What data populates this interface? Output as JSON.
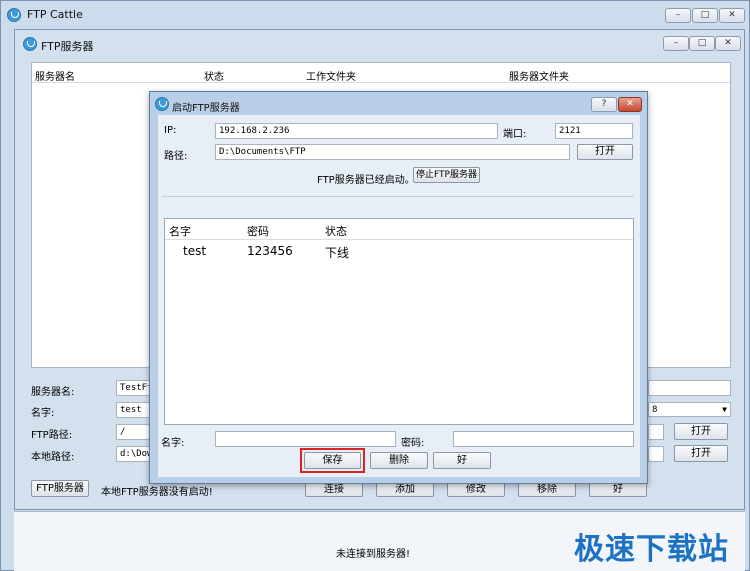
{
  "outer": {
    "title": "FTP Cattle"
  },
  "inner": {
    "title": "FTP服务器"
  },
  "server_table": {
    "columns": [
      "服务器名",
      "状态",
      "工作文件夹",
      "服务器文件夹"
    ]
  },
  "form": {
    "server_name_label": "服务器名:",
    "server_name_value": "TestFt",
    "name_label": "名字:",
    "name_value": "test",
    "ftp_path_label": "FTP路径:",
    "ftp_path_value": "/",
    "local_path_label": "本地路径:",
    "local_path_value": "d:\\Dow",
    "encoding_value": "8",
    "open_label": "打开"
  },
  "bottom": {
    "ftp_server_button": "FTP服务器",
    "local_status": "本地FTP服务器没有启动!",
    "connect": "连接",
    "add": "添加",
    "modify": "修改",
    "remove": "移除",
    "ok": "好"
  },
  "status": {
    "text": "未连接到服务器!"
  },
  "dialog": {
    "title": "启动FTP服务器",
    "help": "?",
    "ip_label": "IP:",
    "ip_value": "192.168.2.236",
    "port_label": "端口:",
    "port_value": "2121",
    "path_label": "路径:",
    "path_value": "D:\\Documents\\FTP",
    "open_label": "打开",
    "status_text": "FTP服务器已经启动。",
    "stop_button": "停止FTP服务器",
    "columns": [
      "名字",
      "密码",
      "状态"
    ],
    "rows": [
      {
        "name": "test",
        "password": "123456",
        "state": "下线"
      }
    ],
    "name_label": "名字:",
    "password_label": "密码:",
    "save": "保存",
    "delete": "删除",
    "ok": "好"
  },
  "watermark": "极速下载站",
  "colors": {
    "highlight": "#d9251d",
    "watermark": "#1e72c4"
  }
}
